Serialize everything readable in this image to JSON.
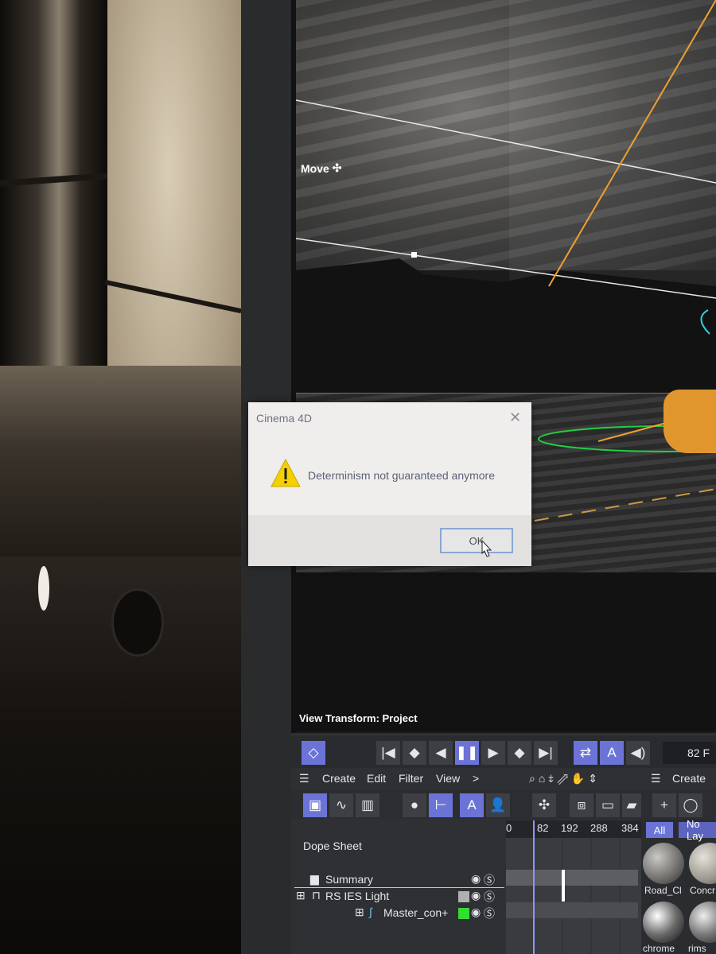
{
  "viewport": {
    "move_label": "Move",
    "view_transform": "View Transform: Project"
  },
  "dialog": {
    "title": "Cinema 4D",
    "close_glyph": "✕",
    "message": "Determinism not guaranteed anymore",
    "ok_label": "OK"
  },
  "transport": {
    "current_frame": "82 F",
    "icons": [
      "keyframe-mode-icon",
      "go-to-start-icon",
      "previous-keyframe-icon",
      "step-back-icon",
      "pause-icon",
      "step-forward-icon",
      "next-keyframe-icon",
      "go-to-end-icon",
      "loop-icon",
      "autokey-icon",
      "sound-icon"
    ]
  },
  "timeline_menu": {
    "items": [
      "Create",
      "Edit",
      "Filter",
      "View",
      ">"
    ]
  },
  "material_menu": {
    "create": "Create"
  },
  "dopesheet": {
    "label": "Dope Sheet",
    "ruler": [
      "0",
      "82",
      "192",
      "288",
      "384"
    ],
    "rows": [
      {
        "label": "Summary"
      },
      {
        "label": "RS IES Light"
      },
      {
        "label": "Master_con+"
      }
    ]
  },
  "materials": {
    "filters": [
      "All",
      "No Lay"
    ],
    "items": [
      "Road_Cl",
      "Concr",
      "chrome",
      "rims"
    ]
  },
  "colors": {
    "accent": "#6b74d6",
    "panel_bg": "#2f3034",
    "dialog_bg": "#efeeec",
    "ok_border": "#8aa7d5",
    "warning_yellow": "#f4d000",
    "layer_green": "#33dd33"
  }
}
